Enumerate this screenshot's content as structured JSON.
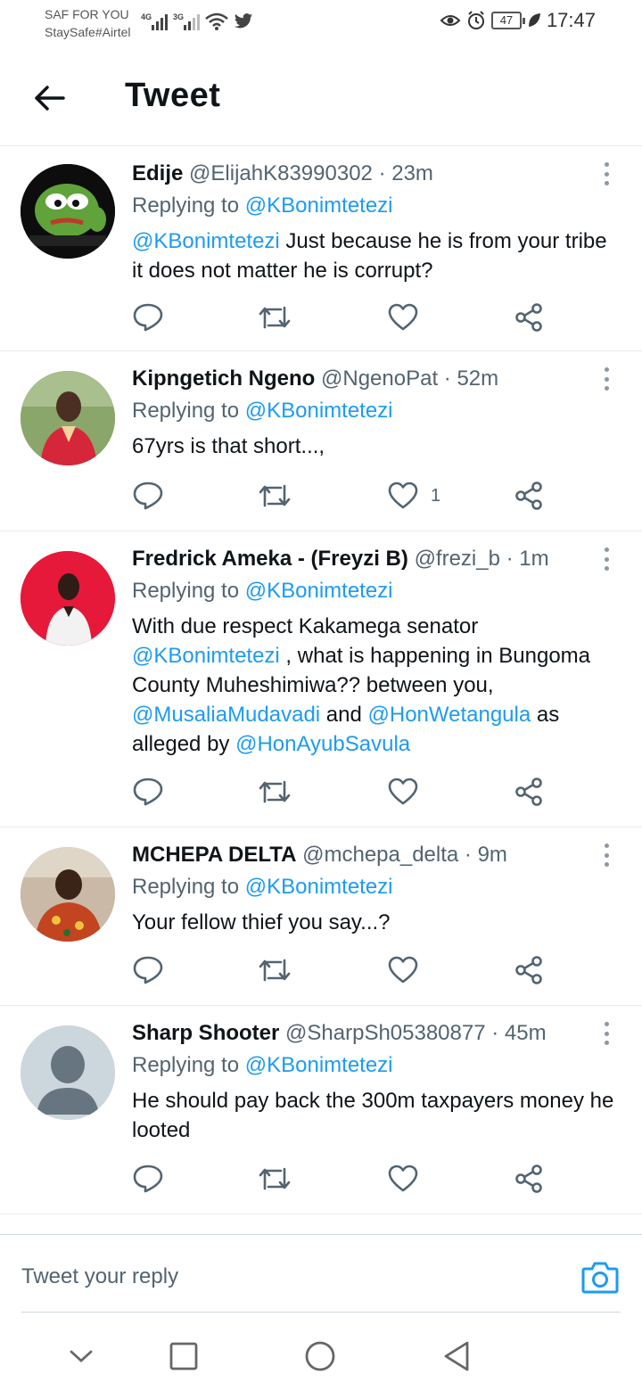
{
  "status_bar": {
    "carrier_line1": "SAF FOR YOU",
    "carrier_line2": "StaySafe#Airtel",
    "net1": "4G",
    "net2": "3G",
    "battery": "47",
    "time": "17:47"
  },
  "header": {
    "title": "Tweet"
  },
  "tweets": [
    {
      "name": "Edije",
      "handle": "@ElijahK83990302",
      "time": "· 23m",
      "replying_prefix": "Replying to ",
      "replying_to": "@KBonimtetezi",
      "text_mention": "@KBonimtetezi",
      "text": " Just because he is from your tribe it does not matter he is corrupt?"
    },
    {
      "name": "Kipngetich Ngeno",
      "handle": "@NgenoPat",
      "time": "· 52m",
      "replying_prefix": "Replying to ",
      "replying_to": "@KBonimtetezi",
      "text": "67yrs is that short...,",
      "likes": "1"
    },
    {
      "name": "Fredrick Ameka - (Freyzi B)",
      "handle": "@frezi_b",
      "time": "· 1m",
      "replying_prefix": "Replying to ",
      "replying_to": "@KBonimtetezi",
      "text_a": "With due respect Kakamega senator ",
      "mention_a": "@KBonimtetezi",
      "text_b": " , what is happening in Bungoma County Muheshimiwa??  between you, ",
      "mention_b": "@MusaliaMudavadi",
      "text_c": "  and ",
      "mention_c": "@HonWetangula",
      "text_d": " as alleged by ",
      "mention_d": "@HonAyubSavula"
    },
    {
      "name": "MCHEPA DELTA",
      "handle": "@mchepa_delta",
      "time": "· 9m",
      "replying_prefix": "Replying to ",
      "replying_to": "@KBonimtetezi",
      "text": "Your fellow thief you say...?"
    },
    {
      "name": "Sharp Shooter",
      "handle": "@SharpSh05380877",
      "time": "· 45m",
      "replying_prefix": "Replying to ",
      "replying_to": "@KBonimtetezi",
      "text": "He should pay back the 300m taxpayers money he looted"
    }
  ],
  "reply_bar": {
    "placeholder": "Tweet your reply"
  },
  "colors": {
    "link": "#1d9bf0",
    "secondary": "#536471",
    "divider": "#e6ecf0"
  },
  "icons": [
    "back-arrow-icon",
    "more-icon",
    "reply-icon",
    "retweet-icon",
    "like-icon",
    "share-icon",
    "camera-icon",
    "chevron-down-icon",
    "square-icon",
    "circle-icon",
    "triangle-back-icon"
  ]
}
